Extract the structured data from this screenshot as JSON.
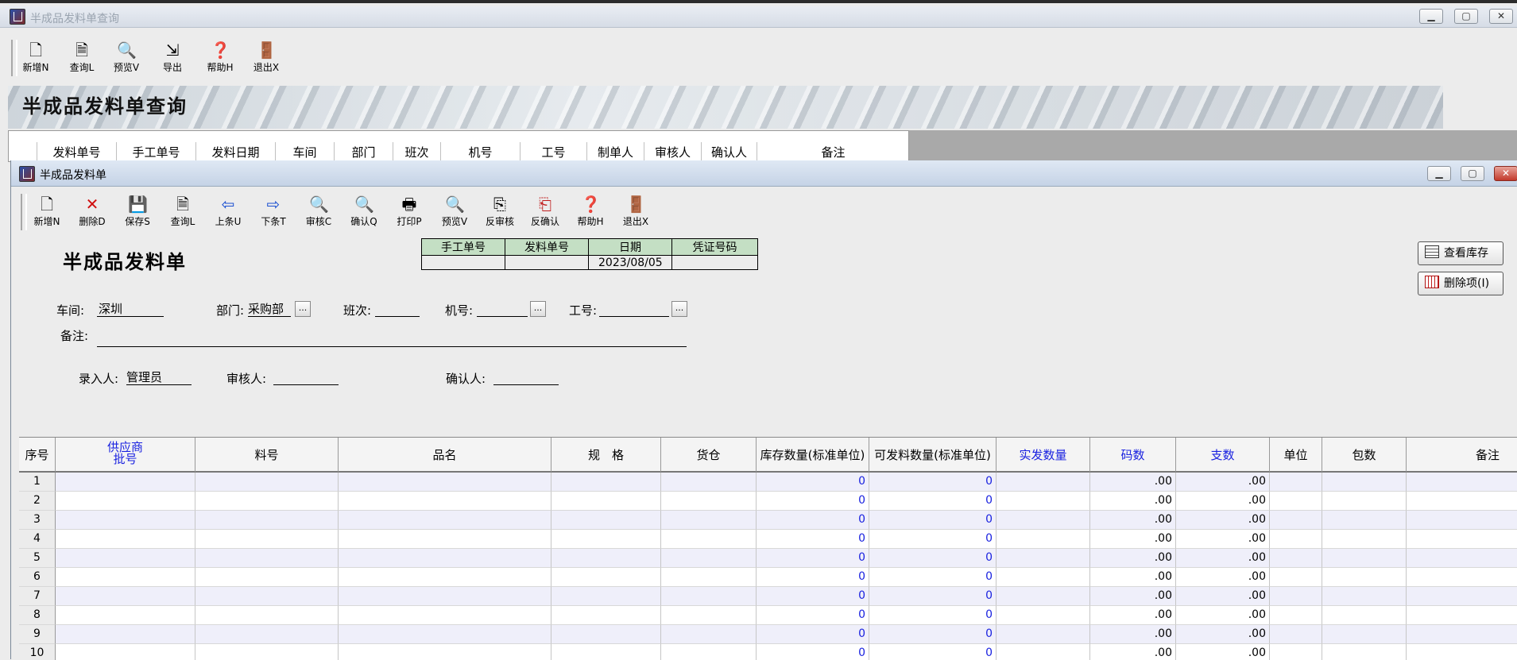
{
  "outer": {
    "title": "半成品发料单查询",
    "toolbar": [
      {
        "label": "新增N",
        "icon": "new-document-icon"
      },
      {
        "label": "查询L",
        "icon": "query-document-icon"
      },
      {
        "label": "预览V",
        "icon": "magnifier-icon"
      },
      {
        "label": "导出",
        "icon": "export-icon"
      },
      {
        "label": "帮助H",
        "icon": "help-icon"
      },
      {
        "label": "退出X",
        "icon": "exit-door-icon"
      }
    ],
    "banner_title": "半成品发料单查询",
    "columns": [
      "发料单号",
      "手工单号",
      "发料日期",
      "车间",
      "部门",
      "班次",
      "机号",
      "工号",
      "制单人",
      "审核人",
      "确认人",
      "备注"
    ]
  },
  "inner": {
    "title": "半成品发料单",
    "toolbar": [
      {
        "label": "新增N",
        "icon": "new-document-icon"
      },
      {
        "label": "删除D",
        "icon": "delete-x-icon"
      },
      {
        "label": "保存S",
        "icon": "save-disk-icon"
      },
      {
        "label": "查询L",
        "icon": "query-document-icon"
      },
      {
        "label": "上条U",
        "icon": "arrow-left-icon"
      },
      {
        "label": "下条T",
        "icon": "arrow-right-icon"
      },
      {
        "label": "审核C",
        "icon": "magnifier-icon"
      },
      {
        "label": "确认Q",
        "icon": "magnifier-icon"
      },
      {
        "label": "打印P",
        "icon": "printer-icon"
      },
      {
        "label": "预览V",
        "icon": "magnifier-icon"
      },
      {
        "label": "反审核",
        "icon": "unapprove-icon"
      },
      {
        "label": "反确认",
        "icon": "unconfirm-icon"
      },
      {
        "label": "帮助H",
        "icon": "help-icon"
      },
      {
        "label": "退出X",
        "icon": "exit-door-icon"
      }
    ],
    "form_title": "半成品发料单",
    "header_table": {
      "headers": [
        "手工单号",
        "发料单号",
        "日期",
        "凭证号码"
      ],
      "values": [
        "",
        "",
        "2023/08/05",
        ""
      ]
    },
    "side_buttons": {
      "stock": "查看库存",
      "delete_item": "删除项(I)"
    },
    "fields": {
      "workshop_label": "车间:",
      "workshop_value": "深圳",
      "dept_label": "部门:",
      "dept_value": "采购部",
      "shift_label": "班次:",
      "shift_value": "",
      "machine_label": "机号:",
      "machine_value": "",
      "worker_label": "工号:",
      "worker_value": "",
      "remark_label": "备注:",
      "remark_value": "",
      "entry_label": "录入人:",
      "entry_value": "管理员",
      "reviewer_label": "审核人:",
      "reviewer_value": "",
      "confirmer_label": "确认人:",
      "confirmer_value": "",
      "ellipsis": "..."
    },
    "grid": {
      "headers": {
        "idx": "序号",
        "supplier_line1": "供应商",
        "supplier_line2": "批号",
        "part_no": "料号",
        "name": "品名",
        "spec": "规　格",
        "warehouse": "货仓",
        "stock_qty": "库存数量(标准单位)",
        "issuable_qty": "可发料数量(标准单位)",
        "actual_qty": "实发数量",
        "code_count": "码数",
        "piece_count": "支数",
        "unit": "单位",
        "package": "包数",
        "remark": "备注"
      },
      "rows": [
        {
          "idx": "1",
          "stock": "0",
          "issuable": "0",
          "code": ".00",
          "piece": ".00"
        },
        {
          "idx": "2",
          "stock": "0",
          "issuable": "0",
          "code": ".00",
          "piece": ".00"
        },
        {
          "idx": "3",
          "stock": "0",
          "issuable": "0",
          "code": ".00",
          "piece": ".00"
        },
        {
          "idx": "4",
          "stock": "0",
          "issuable": "0",
          "code": ".00",
          "piece": ".00"
        },
        {
          "idx": "5",
          "stock": "0",
          "issuable": "0",
          "code": ".00",
          "piece": ".00"
        },
        {
          "idx": "6",
          "stock": "0",
          "issuable": "0",
          "code": ".00",
          "piece": ".00"
        },
        {
          "idx": "7",
          "stock": "0",
          "issuable": "0",
          "code": ".00",
          "piece": ".00"
        },
        {
          "idx": "8",
          "stock": "0",
          "issuable": "0",
          "code": ".00",
          "piece": ".00"
        },
        {
          "idx": "9",
          "stock": "0",
          "issuable": "0",
          "code": ".00",
          "piece": ".00"
        },
        {
          "idx": "10",
          "stock": "0",
          "issuable": "0",
          "code": ".00",
          "piece": ".00"
        }
      ]
    }
  }
}
